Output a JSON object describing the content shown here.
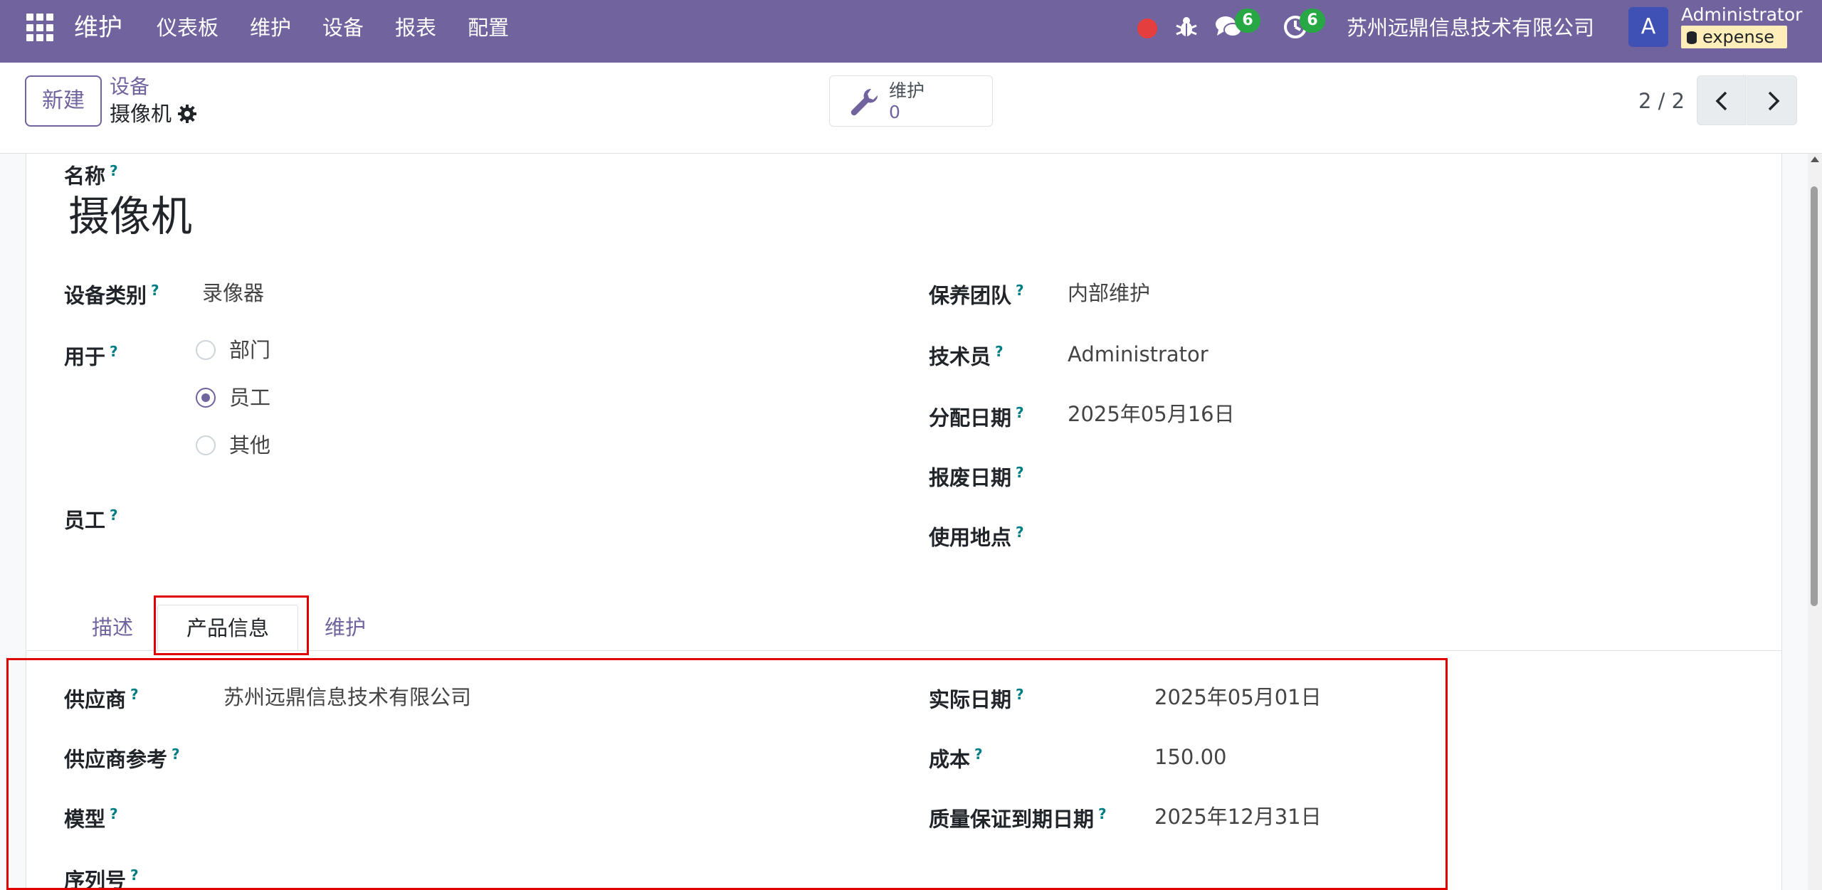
{
  "navbar": {
    "brand": "维护",
    "menu": [
      "仪表板",
      "维护",
      "设备",
      "报表",
      "配置"
    ],
    "chat_count": "6",
    "activity_count": "6",
    "company": "苏州远鼎信息技术有限公司",
    "avatar_letter": "A",
    "user": "Administrator",
    "database": "expense"
  },
  "control": {
    "new_button": "新建",
    "breadcrumb_parent": "设备",
    "breadcrumb_current": "摄像机",
    "smart_button_label": "维护",
    "smart_button_value": "0",
    "pager": "2 / 2"
  },
  "form": {
    "name_label": "名称",
    "name_value": "摄像机",
    "q": "?",
    "left": {
      "category_label": "设备类别",
      "category_value": "录像器",
      "used_for_label": "用于",
      "radio_options": [
        "部门",
        "员工",
        "其他"
      ],
      "selected_option": "员工",
      "employee_label": "员工"
    },
    "right": {
      "team_label": "保养团队",
      "team_value": "内部维护",
      "technician_label": "技术员",
      "technician_value": "Administrator",
      "assign_date_label": "分配日期",
      "assign_date_value": "2025年05月16日",
      "scrap_date_label": "报废日期",
      "location_label": "使用地点"
    },
    "tabs": [
      "描述",
      "产品信息",
      "维护"
    ],
    "active_tab": "产品信息",
    "product": {
      "vendor_label": "供应商",
      "vendor_value": "苏州远鼎信息技术有限公司",
      "vendor_ref_label": "供应商参考",
      "model_label": "模型",
      "serial_label": "序列号",
      "effective_date_label": "实际日期",
      "effective_date_value": "2025年05月01日",
      "cost_label": "成本",
      "cost_value": "150.00",
      "warranty_label": "质量保证到期日期",
      "warranty_value": "2025年12月31日"
    }
  },
  "colors": {
    "brand": "#71639e",
    "badge": "#28a745",
    "highlight": "#e00000"
  }
}
